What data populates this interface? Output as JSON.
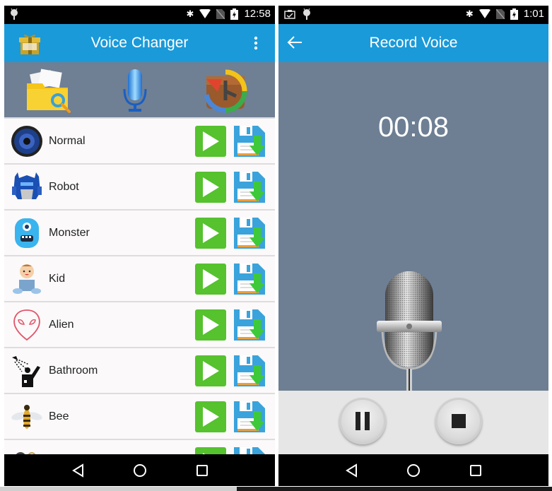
{
  "left_screen": {
    "status_bar": {
      "time": "12:58",
      "icons": [
        "android-debug-icon",
        "bluetooth-icon",
        "wifi-icon",
        "no-sim-icon",
        "battery-charging-icon"
      ]
    },
    "app_bar": {
      "title": "Voice Changer",
      "left_icon": "gift-icon",
      "menu_icon": "overflow-menu-icon"
    },
    "toolbar": {
      "buttons": [
        {
          "name": "file-browser",
          "icon": "folder-search-icon"
        },
        {
          "name": "record",
          "icon": "microphone-icon"
        },
        {
          "name": "history",
          "icon": "restore-icon"
        }
      ]
    },
    "effects": [
      {
        "label": "Normal",
        "icon": "speaker-icon"
      },
      {
        "label": "Robot",
        "icon": "robot-icon"
      },
      {
        "label": "Monster",
        "icon": "monster-icon"
      },
      {
        "label": "Kid",
        "icon": "baby-icon"
      },
      {
        "label": "Alien",
        "icon": "alien-icon"
      },
      {
        "label": "Bathroom",
        "icon": "shower-icon"
      },
      {
        "label": "Bee",
        "icon": "bee-icon"
      },
      {
        "label": "",
        "icon": "partial-icon"
      }
    ],
    "row_actions": {
      "play": "play-icon",
      "save": "save-icon"
    },
    "colors": {
      "app_bar": "#1a9ad9",
      "toolbar": "#6f7f94",
      "play": "#55c22e",
      "save": "#3aa3dc"
    }
  },
  "right_screen": {
    "status_bar": {
      "time": "1:01",
      "icons": [
        "screenshot-icon",
        "android-debug-icon",
        "bluetooth-icon",
        "wifi-icon",
        "no-sim-icon",
        "battery-charging-icon"
      ]
    },
    "app_bar": {
      "title": "Record Voice",
      "back_icon": "back-arrow-icon"
    },
    "timer": "00:08",
    "controls": {
      "pause": "pause-icon",
      "stop": "stop-icon"
    },
    "colors": {
      "body": "#6e7f94",
      "controls_bg": "#e6e6e6"
    }
  },
  "nav_bar": {
    "back": "nav-back-icon",
    "home": "nav-home-icon",
    "recents": "nav-recents-icon"
  }
}
